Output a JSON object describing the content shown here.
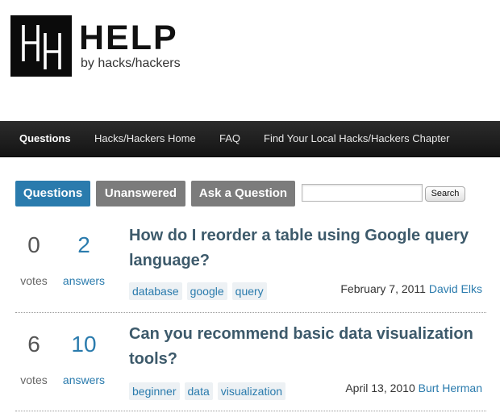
{
  "site": {
    "title": "HELP",
    "subtitle": "by hacks/hackers"
  },
  "nav": {
    "items": [
      {
        "label": "Questions",
        "active": true
      },
      {
        "label": "Hacks/Hackers Home"
      },
      {
        "label": "FAQ"
      },
      {
        "label": "Find Your Local Hacks/Hackers Chapter"
      }
    ]
  },
  "subnav": {
    "questions_label": "Questions",
    "unanswered_label": "Unanswered",
    "ask_label": "Ask a Question",
    "search_value": "",
    "search_button_label": "Search"
  },
  "questions": [
    {
      "votes": "0",
      "votes_label": "votes",
      "answers": "2",
      "answers_label": "answers",
      "title": "How do I reorder a table using Google query language?",
      "tags": [
        "database",
        "google",
        "query"
      ],
      "date": "February 7, 2011",
      "author": "David Elks"
    },
    {
      "votes": "6",
      "votes_label": "votes",
      "answers": "10",
      "answers_label": "answers",
      "title": "Can you recommend basic data visualization tools?",
      "tags": [
        "beginner",
        "data",
        "visualization"
      ],
      "date": "April 13, 2010",
      "author": "Burt Herman"
    }
  ],
  "colors": {
    "accent": "#2a7bad",
    "nav_bg": "#1e1e1e",
    "pill_grey": "#7c7c7c",
    "title": "#3d5a6b"
  }
}
